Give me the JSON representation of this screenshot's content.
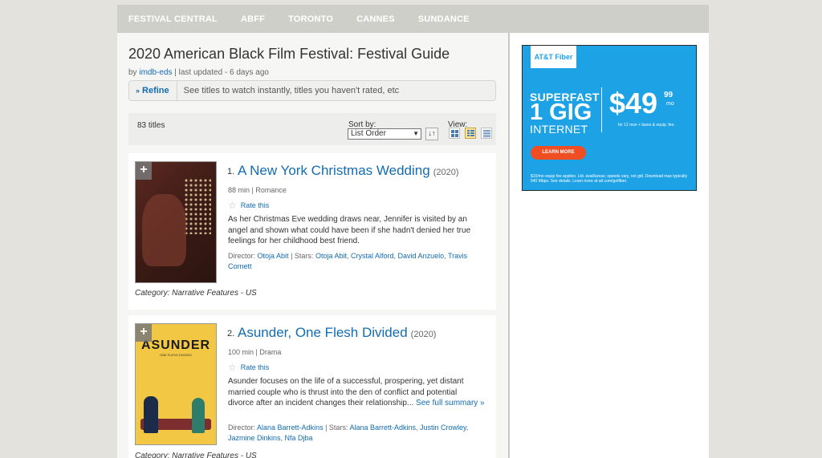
{
  "nav": [
    "FESTIVAL CENTRAL",
    "ABFF",
    "TORONTO",
    "CANNES",
    "SUNDANCE"
  ],
  "page": {
    "title": "2020 American Black Film Festival: Festival Guide",
    "by_label": "by",
    "author": "imdb-eds",
    "updated": "| last updated - 6 days ago"
  },
  "refine": {
    "label": "Refine",
    "hint": "See titles to watch instantly, titles you haven't rated, etc"
  },
  "list_controls": {
    "count": "83 titles",
    "sort_label": "Sort by:",
    "sort_value": "List Order",
    "view_label": "View:"
  },
  "items": [
    {
      "index": "1.",
      "title": "A New York Christmas Wedding",
      "year": "(2020)",
      "meta": "88 min | Romance",
      "rate": "Rate this",
      "description": "As her Christmas Eve wedding draws near, Jennifer is visited by an angel and shown what could have been if she hadn't denied her true feelings for her childhood best friend.",
      "director_label": "Director:",
      "director": "Otoja Abit",
      "stars_label": "| Stars:",
      "stars": [
        "Otoja Abit",
        "Crystal Alford",
        "David Anzuelo",
        "Travis Cornett"
      ],
      "category": "Category: Narrative Features - US"
    },
    {
      "index": "2.",
      "title": "Asunder, One Flesh Divided",
      "year": "(2020)",
      "meta": "100 min | Drama",
      "rate": "Rate this",
      "description": "Asunder focuses on the life of a successful, prospering, yet distant married couple who is thrust into the den of conflict and potential divorce after an incident changes their relationship...",
      "more": "See full summary »",
      "director_label": "Director:",
      "director": "Alana Barrett-Adkins",
      "stars_label": "| Stars:",
      "stars": [
        "Alana Barrett-Adkins",
        "Justin Crowley",
        "Jazmine Dinkins",
        "Nfa Djba"
      ],
      "category": "Category: Narrative Features - US",
      "poster_text": "ASUNDER",
      "poster_subtext": "ONE FLESH DIVIDED"
    }
  ],
  "ad": {
    "brand": "AT&T Fiber",
    "line1": "SUPERFAST",
    "line2": "1 GIG",
    "line3": "INTERNET",
    "price": "$49",
    "cents": "99",
    "per": "mo",
    "terms": "for 12 mos + taxes & equip. fee.",
    "cta": "LEARN MORE",
    "disclaimer": "$10/mo equip fee applies. Ltd. avail/areas; speeds vary, not gtd. Download max typically 940 Mbps. See details. Learn more at att.com/getfiber.",
    "color": "#1ea2e6",
    "cta_color": "#f04d23"
  }
}
